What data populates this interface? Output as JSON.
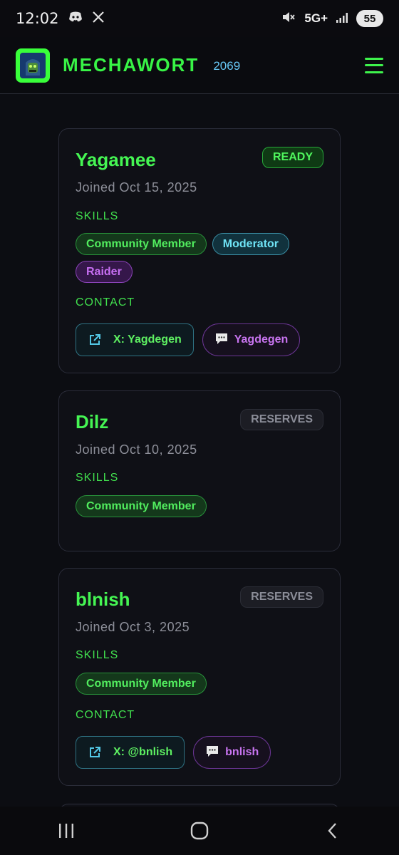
{
  "status": {
    "time": "12:02",
    "network": "5G+",
    "battery": "55",
    "icons": [
      "discord-icon",
      "x-icon",
      "mute-icon",
      "signal-icon"
    ]
  },
  "header": {
    "brand": "MECHAWORT",
    "count": "2069"
  },
  "colors": {
    "accent_green": "#45f553",
    "accent_cyan": "#6fe3f5",
    "accent_purple": "#c76ff2",
    "background": "#0c0d12"
  },
  "members": [
    {
      "name": "Yagamee",
      "status": "READY",
      "joined": "Joined Oct 15, 2025",
      "skills_label": "SKILLS",
      "skills": [
        "Community Member",
        "Moderator",
        "Raider"
      ],
      "contact_label": "CONTACT",
      "x_handle": "X: Yagdegen",
      "discord": "Yagdegen"
    },
    {
      "name": "Dilz",
      "status": "RESERVES",
      "joined": "Joined Oct 10, 2025",
      "skills_label": "SKILLS",
      "skills": [
        "Community Member"
      ]
    },
    {
      "name": "blnish",
      "status": "RESERVES",
      "joined": "Joined Oct 3, 2025",
      "skills_label": "SKILLS",
      "skills": [
        "Community Member"
      ],
      "contact_label": "CONTACT",
      "x_handle": "X: @bnlish",
      "discord": "bnlish"
    }
  ]
}
